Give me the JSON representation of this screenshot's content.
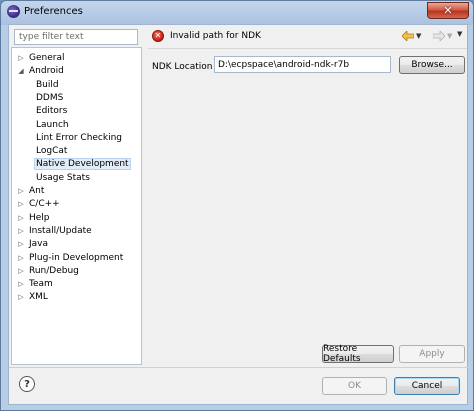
{
  "window": {
    "title": "Preferences",
    "close_glyph": "✕"
  },
  "sidebar": {
    "filter_placeholder": "type filter text",
    "items": [
      {
        "label": "General",
        "level": 0,
        "arrow": "▷"
      },
      {
        "label": "Android",
        "level": 0,
        "arrow": "◢"
      },
      {
        "label": "Build",
        "level": 1,
        "arrow": ""
      },
      {
        "label": "DDMS",
        "level": 1,
        "arrow": ""
      },
      {
        "label": "Editors",
        "level": 1,
        "arrow": ""
      },
      {
        "label": "Launch",
        "level": 1,
        "arrow": ""
      },
      {
        "label": "Lint Error Checking",
        "level": 1,
        "arrow": ""
      },
      {
        "label": "LogCat",
        "level": 1,
        "arrow": ""
      },
      {
        "label": "Native Development",
        "level": 1,
        "arrow": "",
        "selected": true
      },
      {
        "label": "Usage Stats",
        "level": 1,
        "arrow": ""
      },
      {
        "label": "Ant",
        "level": 0,
        "arrow": "▷"
      },
      {
        "label": "C/C++",
        "level": 0,
        "arrow": "▷"
      },
      {
        "label": "Help",
        "level": 0,
        "arrow": "▷"
      },
      {
        "label": "Install/Update",
        "level": 0,
        "arrow": "▷"
      },
      {
        "label": "Java",
        "level": 0,
        "arrow": "▷"
      },
      {
        "label": "Plug-in Development",
        "level": 0,
        "arrow": "▷"
      },
      {
        "label": "Run/Debug",
        "level": 0,
        "arrow": "▷"
      },
      {
        "label": "Team",
        "level": 0,
        "arrow": "▷"
      },
      {
        "label": "XML",
        "level": 0,
        "arrow": "▷"
      }
    ]
  },
  "page": {
    "message": "Invalid path for NDK",
    "message_icon": "error-icon",
    "ndk_label": "NDK Location",
    "ndk_value": "D:\\ecpspace\\android-ndk-r7b",
    "browse_label": "Browse...",
    "restore_label": "Restore Defaults",
    "apply_label": "Apply"
  },
  "footer": {
    "help_glyph": "?",
    "ok_label": "OK",
    "cancel_label": "Cancel"
  },
  "colors": {
    "selection": "#e1ecf7",
    "error": "#c81f10",
    "back_arrow": "#e8a317"
  }
}
